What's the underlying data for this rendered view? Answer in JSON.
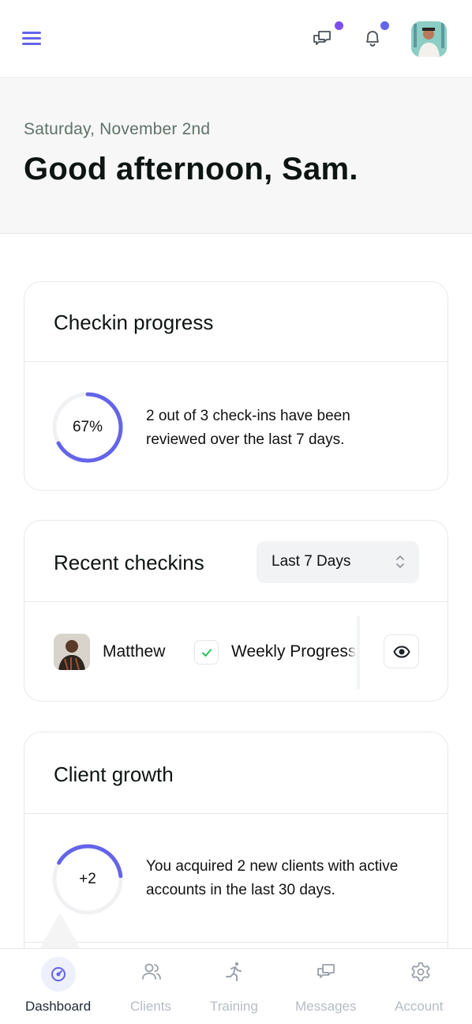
{
  "header": {
    "menu_icon": "hamburger-menu-icon",
    "messages_icon": "chat-bubbles-icon",
    "notifications_icon": "bell-icon",
    "badge_color_messages": "#7c4ef0",
    "badge_color_notifications": "#6464ea"
  },
  "greeting": {
    "date": "Saturday, November 2nd",
    "headline": "Good afternoon, Sam."
  },
  "checkin_progress": {
    "title": "Checkin progress",
    "percent_label": "67%",
    "progress_fraction": 0.67,
    "description": "2 out of 3 check-ins have been reviewed over the last 7 days."
  },
  "recent_checkins": {
    "title": "Recent checkins",
    "range_selected": "Last 7 Days",
    "rows": [
      {
        "client_name": "Matthew",
        "form_name": "Weekly Progress"
      }
    ]
  },
  "client_growth": {
    "title": "Client growth",
    "count_label": "+2",
    "progress_fraction": 0.4,
    "description": "You acquired 2 new clients with active accounts in the last 30 days."
  },
  "bottom_nav": {
    "items": [
      {
        "label": "Dashboard",
        "icon": "dashboard-gauge-icon"
      },
      {
        "label": "Clients",
        "icon": "users-icon"
      },
      {
        "label": "Training",
        "icon": "running-figure-icon"
      },
      {
        "label": "Messages",
        "icon": "chat-bubbles-icon"
      },
      {
        "label": "Account",
        "icon": "gear-icon"
      }
    ]
  },
  "colors": {
    "accent": "#6464ea",
    "ring_track": "#f0f1f3",
    "check_green": "#22c55e"
  }
}
